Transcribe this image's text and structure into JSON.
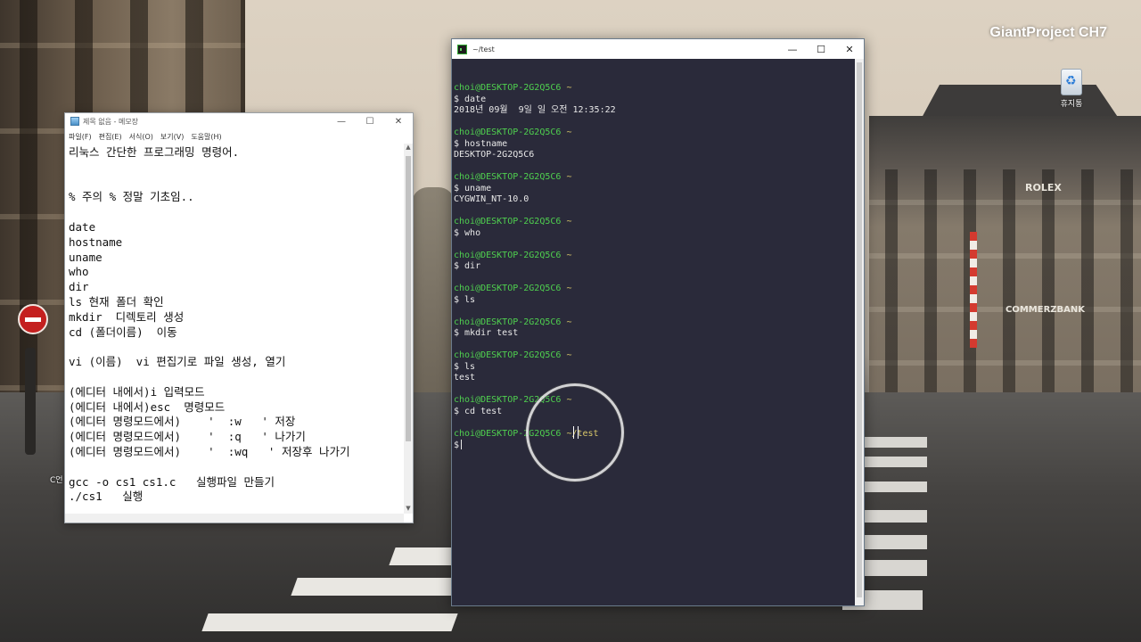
{
  "desktop": {
    "watermark": "GiantProject CH7",
    "recycle_bin_label": "휴지통",
    "desktop_item_label": "C언"
  },
  "notepad": {
    "title": "제목 없음 - 메모장",
    "menu": [
      "파일(F)",
      "편집(E)",
      "서식(O)",
      "보기(V)",
      "도움말(H)"
    ],
    "lines": [
      "리눅스 간단한 프로그래밍 명령어.",
      "",
      "",
      "% 주의 % 정말 기초임..",
      "",
      "date",
      "hostname",
      "uname",
      "who",
      "dir",
      "ls 현재 폴더 확인",
      "mkdir  디렉토리 생성",
      "cd (폴더이름)  이동",
      "",
      "vi (이름)  vi 편집기로 파일 생성, 열기",
      "",
      "(에디터 내에서)i 입력모드",
      "(에디터 내에서)esc  명령모드",
      "(에디터 명령모드에서)    '  :w   ' 저장",
      "(에디터 명령모드에서)    '  :q   ' 나가기",
      "(에디터 명령모드에서)    '  :wq   ' 저장후 나가기",
      "",
      "gcc -o cs1 cs1.c   실행파일 만들기",
      "./cs1   실행"
    ]
  },
  "terminal": {
    "title": "~/test",
    "prompt_user": "choi@DESKTOP-2G2Q5C6",
    "blocks": [
      {
        "path": "~",
        "command": "$ date",
        "output": [
          "2018년 09월  9일 일 오전 12:35:22"
        ]
      },
      {
        "path": "~",
        "command": "$ hostname",
        "output": [
          "DESKTOP-2G2Q5C6"
        ]
      },
      {
        "path": "~",
        "command": "$ uname",
        "output": [
          "CYGWIN_NT-10.0"
        ]
      },
      {
        "path": "~",
        "command": "$ who",
        "output": []
      },
      {
        "path": "~",
        "command": "$ dir",
        "output": []
      },
      {
        "path": "~",
        "command": "$ ls",
        "output": []
      },
      {
        "path": "~",
        "command": "$ mkdir test",
        "output": []
      },
      {
        "path": "~",
        "command": "$ ls",
        "output": [
          "test"
        ]
      },
      {
        "path": "~",
        "command": "$ cd test",
        "output": []
      }
    ],
    "current_path": "~/test",
    "current_prompt": "$"
  }
}
